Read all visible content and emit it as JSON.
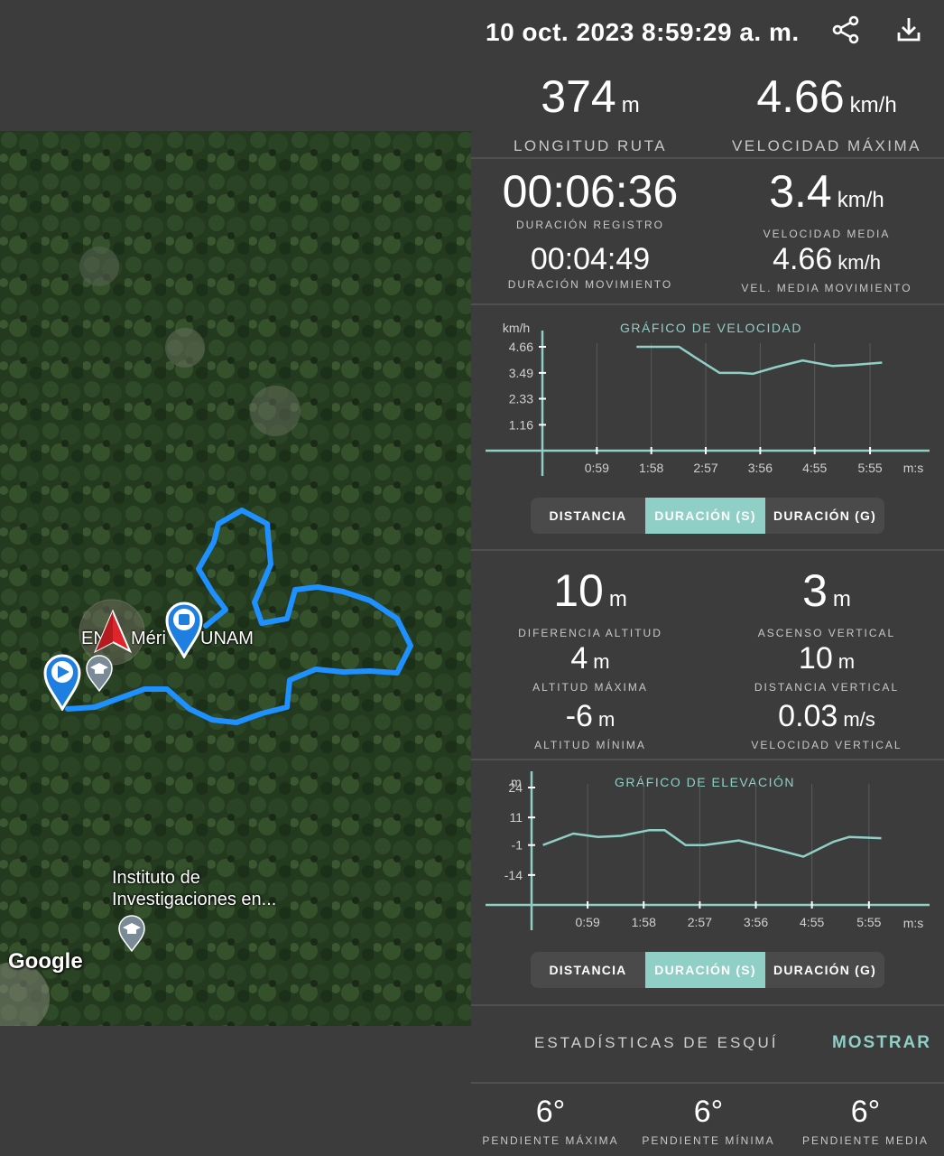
{
  "header": {
    "datetime": "10 oct. 2023 8:59:29 a. m.",
    "share_icon": "share-icon",
    "download_icon": "download-icon"
  },
  "map": {
    "poi_1": "EN",
    "poi_1b": "Méri",
    "poi_1c": "UNAM",
    "poi_2_line1": "Instituto de",
    "poi_2_line2": "Investigaciones en...",
    "logo": "Google",
    "track_color": "#1e90ff"
  },
  "summary": {
    "route_length": {
      "value": "374",
      "unit": "m",
      "label": "LONGITUD RUTA"
    },
    "max_speed": {
      "value": "4.66",
      "unit": "km/h",
      "label": "VELOCIDAD MÁXIMA"
    }
  },
  "durations": {
    "record": {
      "value": "00:06:36",
      "label": "DURACIÓN REGISTRO"
    },
    "avg_speed": {
      "value": "3.4",
      "unit": "km/h",
      "label": "VELOCIDAD MEDIA"
    },
    "moving": {
      "value": "00:04:49",
      "label": "DURACIÓN MOVIMIENTO"
    },
    "moving_avg_speed": {
      "value": "4.66",
      "unit": "km/h",
      "label": "VEL. MEDIA MOVIMIENTO"
    }
  },
  "speed_chart": {
    "title": "GRÁFICO DE VELOCIDAD",
    "y_unit": "km/h",
    "x_unit": "m:s",
    "y_ticks": [
      "4.66",
      "3.49",
      "2.33",
      "1.16"
    ],
    "x_ticks": [
      "0:59",
      "1:58",
      "2:57",
      "3:56",
      "4:55",
      "5:55"
    ]
  },
  "speed_tabs": [
    "DISTANCIA",
    "DURACIÓN (S)",
    "DURACIÓN (G)"
  ],
  "elevation": {
    "diff": {
      "value": "10",
      "unit": "m",
      "label": "DIFERENCIA ALTITUD"
    },
    "ascent": {
      "value": "3",
      "unit": "m",
      "label": "ASCENSO VERTICAL"
    },
    "max_alt": {
      "value": "4",
      "unit": "m",
      "label": "ALTITUD MÁXIMA"
    },
    "vert_dist": {
      "value": "10",
      "unit": "m",
      "label": "DISTANCIA VERTICAL"
    },
    "min_alt": {
      "value": "-6",
      "unit": "m",
      "label": "ALTITUD MÍNIMA"
    },
    "vert_speed": {
      "value": "0.03",
      "unit": "m/s",
      "label": "VELOCIDAD VERTICAL"
    }
  },
  "elevation_chart": {
    "title": "GRÁFICO DE ELEVACIÓN",
    "y_unit": "m",
    "x_unit": "m:s",
    "y_ticks": [
      "24",
      "11",
      "-1",
      "-14"
    ],
    "x_ticks": [
      "0:59",
      "1:58",
      "2:57",
      "3:56",
      "4:55",
      "5:55"
    ]
  },
  "elevation_tabs": [
    "DISTANCIA",
    "DURACIÓN (S)",
    "DURACIÓN (G)"
  ],
  "ski": {
    "label": "ESTADÍSTICAS DE ESQUÍ",
    "button": "MOSTRAR"
  },
  "slopes": {
    "max": {
      "value": "6°",
      "label": "PENDIENTE MÁXIMA"
    },
    "min": {
      "value": "6°",
      "label": "PENDIENTE MÍNIMA"
    },
    "avg": {
      "value": "6°",
      "label": "PENDIENTE MEDIA"
    }
  },
  "colors": {
    "background": "#3c3c3c",
    "accent": "#8fcfc6",
    "track": "#1e90ff"
  },
  "chart_data": [
    {
      "type": "line",
      "title": "GRÁFICO DE VELOCIDAD",
      "ylabel": "km/h",
      "xlabel": "m:s",
      "ylim": [
        0,
        4.66
      ],
      "xlim": [
        "0:00",
        "6:36"
      ],
      "x": [
        "1:42",
        "2:15",
        "2:28",
        "2:45",
        "3:12",
        "3:34",
        "3:48",
        "4:13",
        "4:42",
        "5:14",
        "5:38",
        "6:08"
      ],
      "series": [
        {
          "values": [
            4.66,
            4.66,
            4.66,
            4.2,
            3.49,
            3.49,
            3.45,
            3.75,
            4.05,
            3.8,
            3.85,
            3.95
          ]
        }
      ]
    },
    {
      "type": "line",
      "title": "GRÁFICO DE ELEVACIÓN",
      "ylabel": "m",
      "xlabel": "m:s",
      "ylim": [
        -27,
        24
      ],
      "xlim": [
        "0:00",
        "6:36"
      ],
      "x": [
        "0:12",
        "0:44",
        "1:10",
        "1:34",
        "2:04",
        "2:20",
        "2:42",
        "3:02",
        "3:38",
        "4:18",
        "4:46",
        "5:18",
        "5:34",
        "6:08"
      ],
      "series": [
        {
          "values": [
            -1,
            4,
            2.5,
            3,
            5.5,
            5.5,
            -1,
            -1,
            1,
            -3,
            -6,
            0.5,
            2.5,
            2
          ]
        }
      ]
    }
  ]
}
